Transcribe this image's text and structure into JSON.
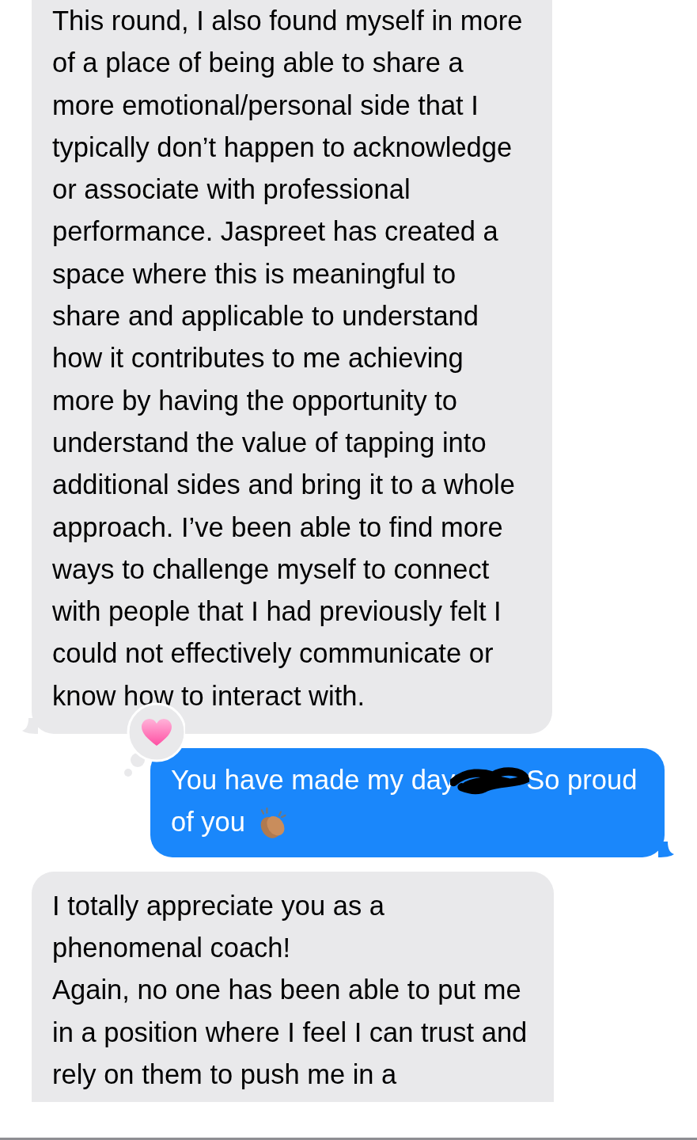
{
  "messages": [
    {
      "kind": "received",
      "tail": true,
      "lines": [
        "This round, I also found myself in more",
        "of a place of being able to share a",
        "more emotional/personal side that I",
        "typically don’t happen to acknowledge",
        "or associate with professional",
        "performance. Jaspreet has created a",
        "space where this is meaningful to",
        "share and applicable to understand",
        "how it contributes to me achieving",
        "more by having the opportunity to",
        "understand the value of tapping into",
        "additional sides and bring it to a whole",
        "approach. I’ve been able to find more",
        "ways to challenge myself to connect",
        "with people that I had previously felt I",
        "could not effectively communicate or",
        "know how to interact with."
      ]
    },
    {
      "kind": "sent",
      "tail": true,
      "reaction": {
        "kind": "heart"
      },
      "text_before": "You have made my day",
      "redacted": true,
      "text_after_lines": [
        "So proud",
        "of you"
      ]
    },
    {
      "kind": "received",
      "tail": false,
      "lines": [
        "I totally appreciate you as a",
        "phenomenal coach!",
        "Again, no one has been able to put me",
        "in a position where I feel I can trust and",
        "rely on them to push me in a"
      ]
    }
  ]
}
